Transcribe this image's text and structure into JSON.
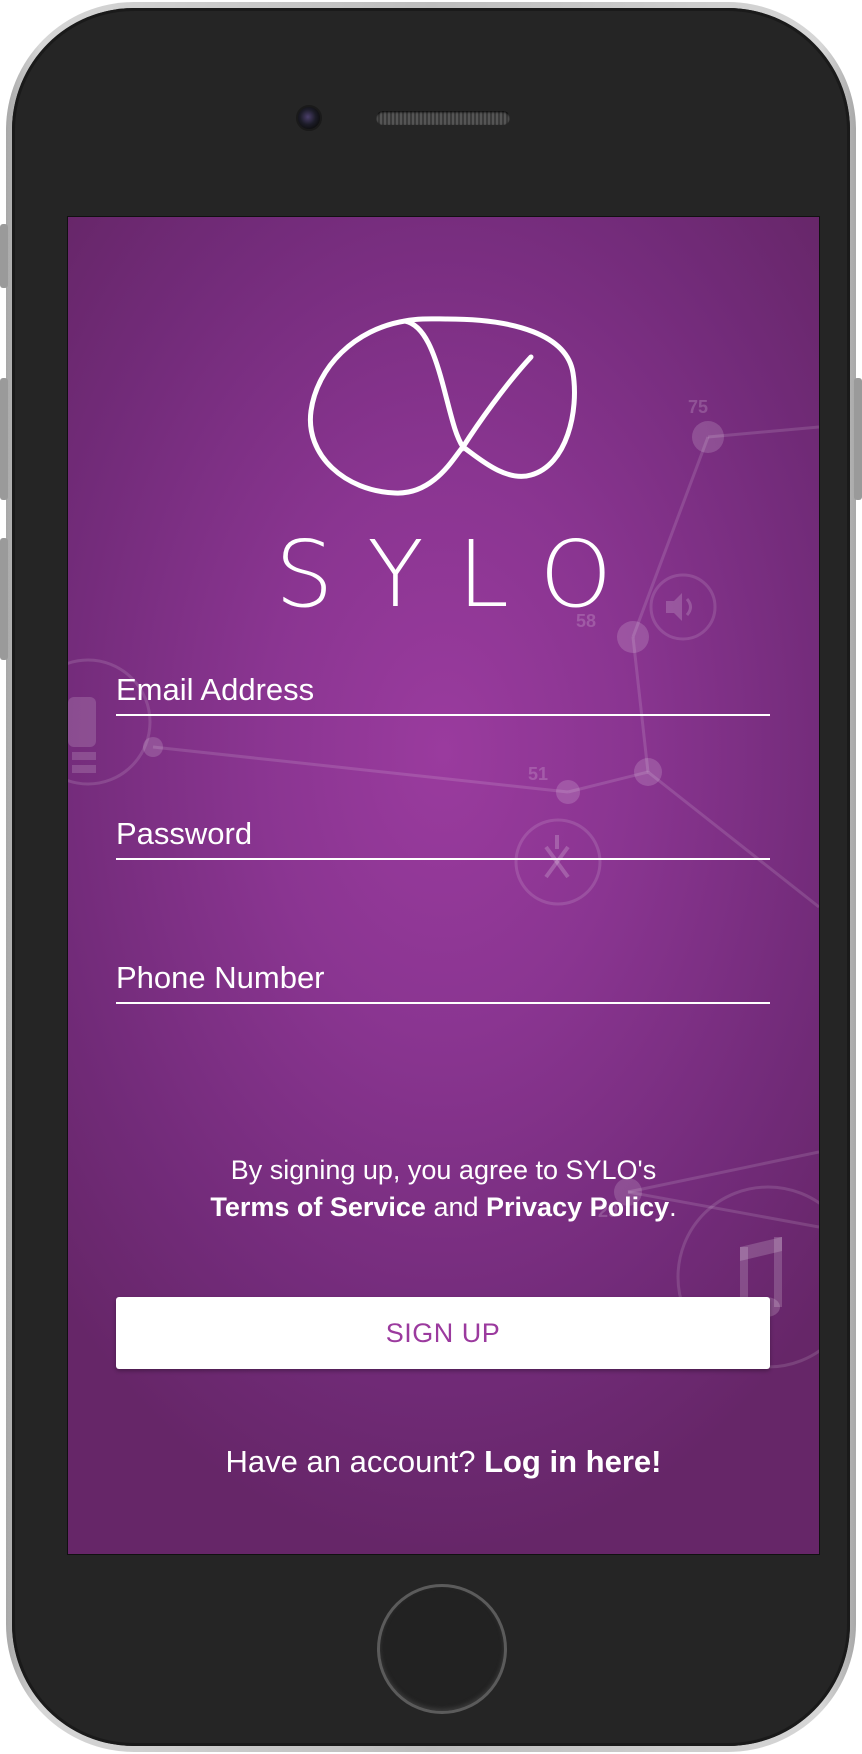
{
  "app": {
    "brand_name": "SYLO"
  },
  "form": {
    "email": {
      "placeholder": "Email Address",
      "value": ""
    },
    "password": {
      "placeholder": "Password",
      "value": ""
    },
    "phone": {
      "placeholder": "Phone Number",
      "value": ""
    }
  },
  "terms": {
    "prefix": "By signing up, you agree to SYLO's",
    "terms_link": "Terms of Service",
    "conjunction": " and ",
    "privacy_link": "Privacy Policy",
    "suffix": "."
  },
  "signup_button": {
    "label": "SIGN UP"
  },
  "login": {
    "prompt": "Have an account? ",
    "link": "Log in here!"
  },
  "background_graph_labels": [
    "75",
    "58",
    "51",
    "29"
  ],
  "icons": [
    "sylo-logo-icon",
    "speaker-icon",
    "restaurant-icon",
    "music-note-icon",
    "building-icon"
  ],
  "colors": {
    "screen_background": "#8a3591",
    "accent": "#9b3a9e",
    "text": "#ffffff",
    "button_background": "#ffffff"
  }
}
